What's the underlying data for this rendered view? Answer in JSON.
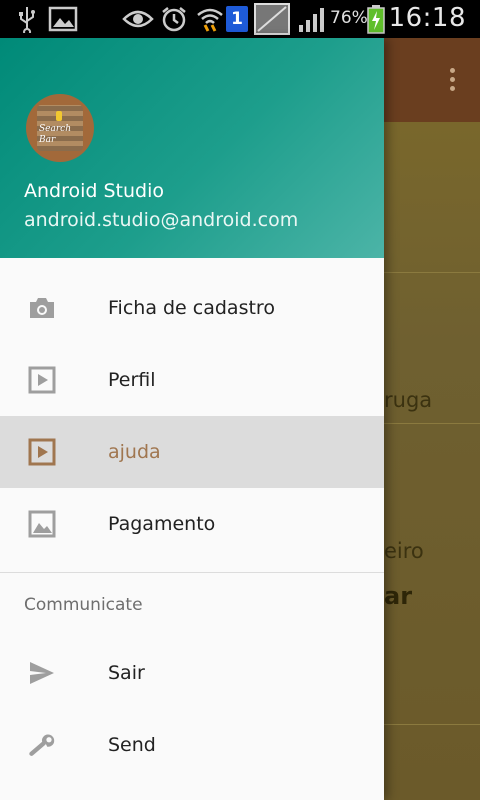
{
  "status_bar": {
    "battery_percent": "76%",
    "time": "16:18",
    "sim_badge": "1",
    "icons": [
      "usb-icon",
      "gallery-icon",
      "eye-icon",
      "alarm-icon",
      "wifi-icon",
      "sim-icon",
      "no-signal-icon",
      "signal-icon",
      "battery-charging-icon"
    ]
  },
  "background_app": {
    "fragments": [
      "ruga",
      "eiro",
      "ar"
    ]
  },
  "drawer": {
    "user_name": "Android Studio",
    "user_email": "android.studio@android.com",
    "avatar_text": [
      "Search",
      "Bar"
    ],
    "items": [
      {
        "label": "Ficha de cadastro",
        "icon": "camera-icon"
      },
      {
        "label": "Perfil",
        "icon": "slideshow-icon"
      },
      {
        "label": "ajuda",
        "icon": "slideshow-icon",
        "active": true
      },
      {
        "label": "Pagamento",
        "icon": "image-icon"
      }
    ],
    "section_title": "Communicate",
    "section_items": [
      {
        "label": "Sair",
        "icon": "send-icon"
      },
      {
        "label": "Send",
        "icon": "wrench-icon"
      }
    ]
  },
  "colors": {
    "header_start": "#008a78",
    "header_end": "#4cb4a7",
    "active_item_bg": "#dcdcdc",
    "active_item_text": "#a0764f",
    "icon_gray": "#9e9e9e"
  }
}
